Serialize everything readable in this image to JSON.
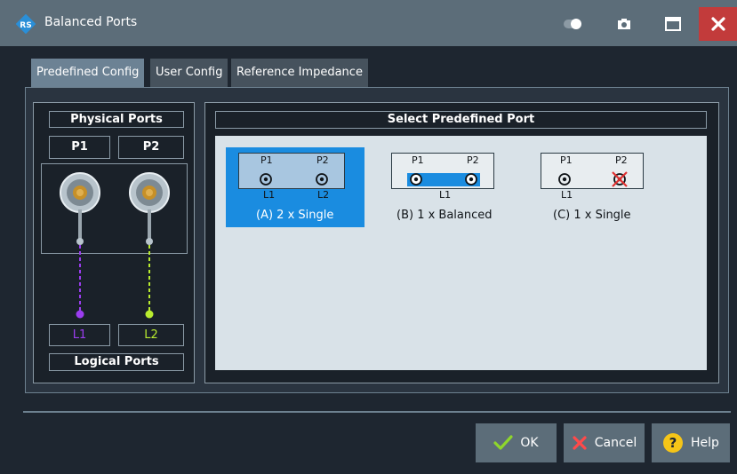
{
  "window": {
    "title": "Balanced Ports",
    "icons": [
      "logo-icon",
      "toggle-icon",
      "camera-icon",
      "maximize-icon",
      "close-icon"
    ]
  },
  "tabs": [
    {
      "label": "Predefined Config",
      "active": true
    },
    {
      "label": "User Config",
      "active": false
    },
    {
      "label": "Reference Impedance",
      "active": false
    }
  ],
  "physical": {
    "header": "Physical Ports",
    "ports": [
      "P1",
      "P2"
    ],
    "logical_ports": [
      "L1",
      "L2"
    ],
    "footer": "Logical Ports",
    "colors": {
      "L1": "#9b3df0",
      "L2": "#b9ec2f"
    }
  },
  "select": {
    "header": "Select Predefined Port",
    "configs": [
      {
        "label": "(A) 2 x Single",
        "ports": [
          "P1",
          "P2"
        ],
        "logical": [
          "L1",
          "L2"
        ],
        "selected": true
      },
      {
        "label": "(B) 1 x Balanced",
        "ports": [
          "P1",
          "P2"
        ],
        "logical": [
          "L1"
        ],
        "selected": false
      },
      {
        "label": "(C) 1 x Single",
        "ports": [
          "P1",
          "P2"
        ],
        "logical": [
          "L1"
        ],
        "selected": false
      }
    ]
  },
  "buttons": {
    "ok": "OK",
    "cancel": "Cancel",
    "help": "Help"
  },
  "colors": {
    "selection": "#1a8ce0",
    "close": "#c23b3b",
    "ok_check": "#8ed62c",
    "cancel_x": "#ff4a4a",
    "help": "#f5c518"
  }
}
